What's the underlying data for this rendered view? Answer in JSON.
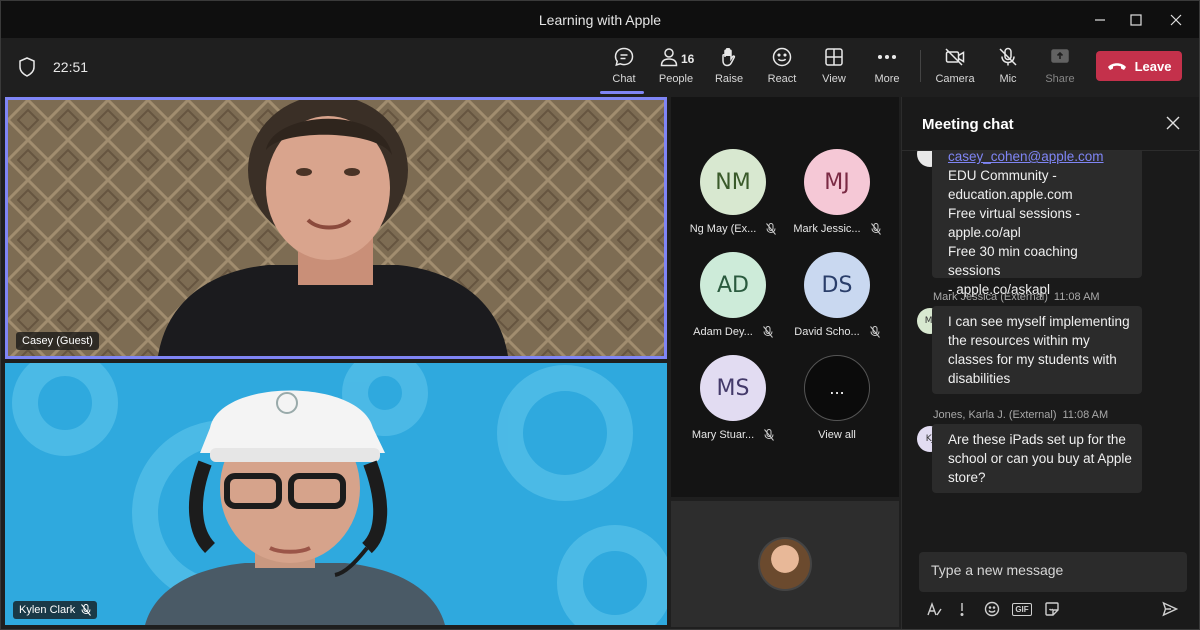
{
  "window": {
    "title": "Learning with Apple"
  },
  "toolbar": {
    "timer": "22:51",
    "chat_label": "Chat",
    "people_label": "People",
    "people_count": "16",
    "raise_label": "Raise",
    "react_label": "React",
    "view_label": "View",
    "more_label": "More",
    "camera_label": "Camera",
    "mic_label": "Mic",
    "share_label": "Share",
    "leave_label": "Leave"
  },
  "videos": [
    {
      "name": "Casey (Guest)"
    },
    {
      "name": "Kylen Clark"
    }
  ],
  "participants": [
    {
      "initials": "NM",
      "name": "Ng May (Ex...",
      "color": "#d8e8d0",
      "text_color": "#3a5a2a"
    },
    {
      "initials": "MJ",
      "name": "Mark Jessic...",
      "color": "#f5c8d6",
      "text_color": "#7a2a44"
    },
    {
      "initials": "AD",
      "name": "Adam Dey...",
      "color": "#cdebd9",
      "text_color": "#2a5a3e"
    },
    {
      "initials": "DS",
      "name": "David Scho...",
      "color": "#c9d8f0",
      "text_color": "#2a3e6a"
    },
    {
      "initials": "MS",
      "name": "Mary Stuar...",
      "color": "#e2dcf2",
      "text_color": "#443a6a"
    }
  ],
  "view_all": {
    "symbol": "...",
    "label": "View all"
  },
  "chat": {
    "title": "Meeting chat",
    "messages": [
      {
        "lines": [
          "casey_cohen@apple.com",
          "EDU Community -",
          "education.apple.com",
          "Free virtual sessions -",
          "apple.co/apl",
          "Free 30 min coaching sessions",
          "- apple.co/askapl"
        ]
      },
      {
        "author": "Mark Jessica (External)",
        "time": "11:08 AM",
        "initials": "MJ",
        "text": "I can see myself implementing the resources within my classes for my students with disabilities"
      },
      {
        "author": "Jones, Karla J. (External)",
        "time": "11:08 AM",
        "initials": "KJ",
        "text": "Are these iPads set up for the school or can you buy at Apple store?"
      }
    ],
    "compose_placeholder": "Type a new message"
  },
  "colors": {
    "accent": "#7f85f5",
    "leave": "#c4314b",
    "video2_bg": "#2fa9de"
  }
}
